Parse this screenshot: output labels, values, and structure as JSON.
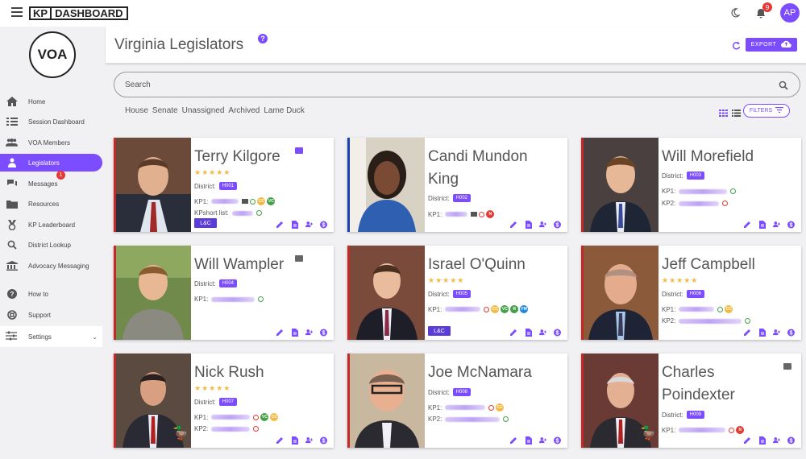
{
  "app": {
    "logo_kp": "KP",
    "logo_dashboard": "DASHBOARD",
    "notifications": "9",
    "avatar_initials": "AP",
    "org_logo": "VOA"
  },
  "sidebar": {
    "items": [
      {
        "label": "Home",
        "icon": "home-icon"
      },
      {
        "label": "Session Dashboard",
        "icon": "checklist-icon"
      },
      {
        "label": "VOA Members",
        "icon": "people-icon"
      },
      {
        "label": "Legislators",
        "icon": "person-icon",
        "active": true
      },
      {
        "label": "Messages",
        "icon": "chat-icon",
        "badge": "1"
      },
      {
        "label": "Resources",
        "icon": "folder-icon"
      },
      {
        "label": "KP Leaderboard",
        "icon": "medal-icon"
      },
      {
        "label": "District Lookup",
        "icon": "search-icon"
      },
      {
        "label": "Advocacy Messaging",
        "icon": "bank-icon"
      },
      {
        "label": "How to",
        "icon": "help-icon"
      },
      {
        "label": "Support",
        "icon": "lifebuoy-icon"
      },
      {
        "label": "Settings",
        "icon": "sliders-icon"
      }
    ]
  },
  "header": {
    "title": "Virginia Legislators",
    "export_label": "EXPORT"
  },
  "search": {
    "placeholder": "Search"
  },
  "filter_tabs": [
    "House",
    "Senate",
    "Unassigned",
    "Archived",
    "Lame Duck"
  ],
  "filters_label": "FILTERS",
  "cards": [
    {
      "name": "Terry Kilgore",
      "district": "H001",
      "district_label": "District:",
      "kp1": "KP1:",
      "extra_label": "KPshort list:",
      "committee": "L&C"
    },
    {
      "name": "Candi Mundon King",
      "district": "H002",
      "district_label": "District:",
      "kp1": "KP1:"
    },
    {
      "name": "Will Morefield",
      "district": "H003",
      "district_label": "District:",
      "kp1": "KP1:",
      "kp2": "KP2:"
    },
    {
      "name": "Will Wampler",
      "district": "H004",
      "district_label": "District:",
      "kp1": "KP1:"
    },
    {
      "name": "Israel O'Quinn",
      "district": "H005",
      "district_label": "District:",
      "kp1": "KP1:",
      "committee": "L&C"
    },
    {
      "name": "Jeff Campbell",
      "district": "H006",
      "district_label": "District:",
      "kp1": "KP1:",
      "kp2": "KP2:"
    },
    {
      "name": "Nick Rush",
      "district": "H007",
      "district_label": "District:",
      "kp1": "KP1:",
      "kp2": "KP2:"
    },
    {
      "name": "Joe McNamara",
      "district": "H008",
      "district_label": "District:",
      "kp1": "KP1:",
      "kp2": "KP2:"
    },
    {
      "name": "Charles Poindexter",
      "district": "H009",
      "district_label": "District:",
      "kp1": "KP1:"
    }
  ],
  "badge_labels": {
    "cc": "CC",
    "vc": "VC",
    "n": "N",
    "r": "R",
    "fm": "FM"
  },
  "colors": {
    "accent": "#7c4dff",
    "gold": "#f5b942",
    "red": "#e53935",
    "green": "#43a047",
    "blue": "#1e88e5"
  }
}
